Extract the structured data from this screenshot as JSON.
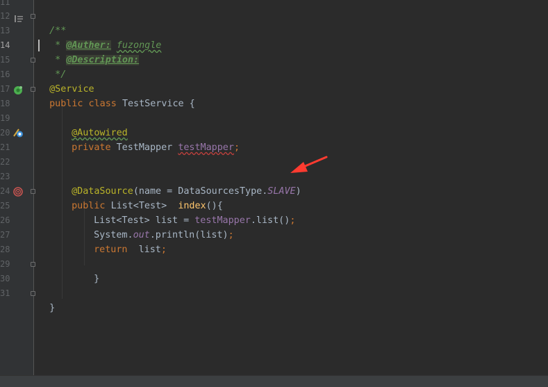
{
  "line_numbers": [
    {
      "n": "11",
      "current": false
    },
    {
      "n": "12",
      "current": false
    },
    {
      "n": "13",
      "current": false
    },
    {
      "n": "14",
      "current": true
    },
    {
      "n": "15",
      "current": false
    },
    {
      "n": "16",
      "current": false
    },
    {
      "n": "17",
      "current": false
    },
    {
      "n": "18",
      "current": false
    },
    {
      "n": "19",
      "current": false
    },
    {
      "n": "20",
      "current": false
    },
    {
      "n": "21",
      "current": false
    },
    {
      "n": "22",
      "current": false
    },
    {
      "n": "23",
      "current": false
    },
    {
      "n": "24",
      "current": false
    },
    {
      "n": "25",
      "current": false
    },
    {
      "n": "26",
      "current": false
    },
    {
      "n": "27",
      "current": false
    },
    {
      "n": "28",
      "current": false
    },
    {
      "n": "29",
      "current": false
    },
    {
      "n": "30",
      "current": false
    },
    {
      "n": "31",
      "current": false
    }
  ],
  "gutter_icons": [
    {
      "line": "12",
      "icon": "structure-list-icon",
      "color": "#8a8a8a"
    },
    {
      "line": "17",
      "icon": "spring-bean-icon",
      "color": "#4caf50"
    },
    {
      "line": "20",
      "icon": "autowired-navigation-icon",
      "color": "#3d8fd6"
    },
    {
      "line": "24",
      "icon": "request-mapping-target-icon",
      "color": "#c75450"
    }
  ],
  "code": {
    "l12": {
      "t0": "/**"
    },
    "l13": {
      "t0": " * ",
      "t1": "@Auther:",
      "t2": " ",
      "t3": "fuzongle"
    },
    "l14": {
      "t0": " * ",
      "t1": "@Description:"
    },
    "l15": {
      "t0": " */"
    },
    "l16": {
      "t0": "@Service"
    },
    "l17": {
      "t0": "public class ",
      "t1": "TestService",
      "t2": " {"
    },
    "l19": {
      "t0": "@Autowired"
    },
    "l20": {
      "t0": "private ",
      "t1": "TestMapper ",
      "t2": "testMapper",
      "t3": ";"
    },
    "l23": {
      "t0": "@DataSource",
      "t1": "(name = DataSourcesType.",
      "t2": "SLAVE",
      "t3": ")"
    },
    "l24": {
      "t0": "public ",
      "t1": "List<Test>  ",
      "t2": "index",
      "t3": "(){"
    },
    "l25": {
      "t0": "List<Test> list = ",
      "t1": "testMapper",
      "t2": ".list()",
      "t3": ";"
    },
    "l26": {
      "t0": "System.",
      "t1": "out",
      "t2": ".println(list)",
      "t3": ";"
    },
    "l27": {
      "t0": "return ",
      "t1": " list",
      "t2": ";"
    },
    "l29": {
      "t0": "}"
    },
    "l31": {
      "t0": "}"
    }
  },
  "colors": {
    "background": "#2b2b2b",
    "gutter": "#313335",
    "keyword": "#cc7832",
    "annotation": "#bbb529",
    "doc_comment": "#629755",
    "field": "#9876aa",
    "method": "#ffc66d",
    "default_text": "#a9b7c6",
    "annotation_arrow": "#ff3b30"
  }
}
